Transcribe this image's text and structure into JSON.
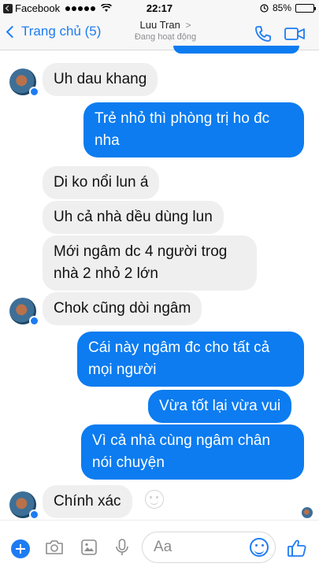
{
  "status_bar": {
    "app": "Facebook",
    "time": "22:17",
    "battery": "85%",
    "battery_level": 0.85
  },
  "header": {
    "back_label": "Trang chủ (5)",
    "contact_name": "Luu Tran",
    "contact_status": "Đang hoạt động",
    "call_icon": "phone-icon",
    "video_icon": "video-camera-icon",
    "accent_color": "#1e7cf2"
  },
  "messages": [
    {
      "side": "in",
      "text": "Uh dau khang"
    },
    {
      "side": "out",
      "text": "Trẻ nhỏ thì phòng trị ho đc nha"
    },
    {
      "side": "in",
      "text": "Di ko nổi lun á"
    },
    {
      "side": "in",
      "text": "Uh cả nhà dều dùng lun"
    },
    {
      "side": "in",
      "text": "Mới ngâm dc 4 người trog nhà 2 nhỏ 2 lớn"
    },
    {
      "side": "in",
      "text": "Chok cũng dòi ngâm"
    },
    {
      "side": "out",
      "text": "Cái này ngâm đc cho tất cả mọi người"
    },
    {
      "side": "out",
      "text": "Vừa tốt lại vừa vui"
    },
    {
      "side": "out",
      "text": "Vì cả nhà cùng ngâm chân nói chuyện"
    },
    {
      "side": "in",
      "text": "Chính xác"
    }
  ],
  "composer": {
    "placeholder": "Aa",
    "icons": [
      "plus-icon",
      "camera-icon",
      "image-icon",
      "microphone-icon",
      "smiley-icon",
      "thumbs-up-icon"
    ]
  },
  "colors": {
    "outgoing": "#0c7cf0",
    "incoming": "#efefef"
  }
}
